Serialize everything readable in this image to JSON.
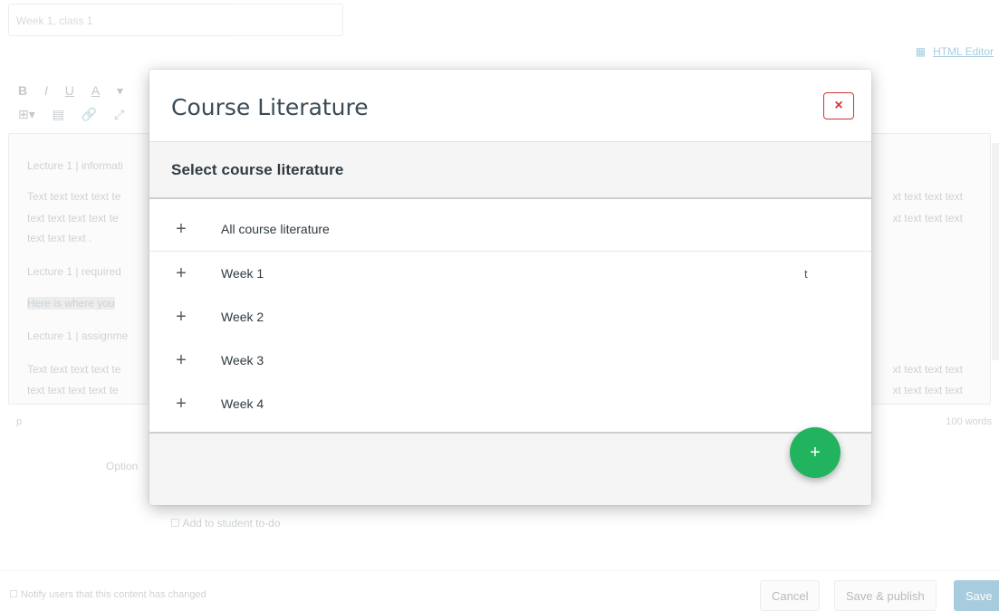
{
  "background": {
    "title_value": "Week 1, class 1",
    "html_editor_label": "HTML Editor",
    "toolbar_row1": [
      "B",
      "I",
      "U",
      "A",
      "▾"
    ],
    "toolbar_row2": [
      "⊞▾",
      "▤",
      "🔗",
      "⤢"
    ],
    "editor_lines": [
      "Lecture 1 | informati",
      "Text text text text te",
      "text text text text te",
      "text text text .",
      "Lecture 1 | required",
      "Here is where you",
      "Lecture 1 | assignme",
      "Text text text text te",
      "text text text text te"
    ],
    "editor_right_lines": [
      "xt text text text",
      "xt text text text",
      "xt text text text",
      "xt text text text"
    ],
    "status_p": "p",
    "word_count": "100 words",
    "options_label": "Option",
    "add_to_student_todo": "Add to student to-do",
    "notify_label": "Notify users that this content has changed",
    "cancel_label": "Cancel",
    "save_publish_label": "Save & publish",
    "save_label": "Save"
  },
  "modal": {
    "title": "Course Literature",
    "close_symbol": "×",
    "section_title": "Select course literature",
    "all_item": "All course literature",
    "items": [
      "Week 1",
      "Week 2",
      "Week 3",
      "Week 4"
    ],
    "stray_char": "t",
    "plus_symbol": "+",
    "fab_symbol": "+"
  },
  "colors": {
    "close_red": "#d4333a",
    "fab_green": "#22b35e",
    "link_blue": "#0770a3"
  }
}
